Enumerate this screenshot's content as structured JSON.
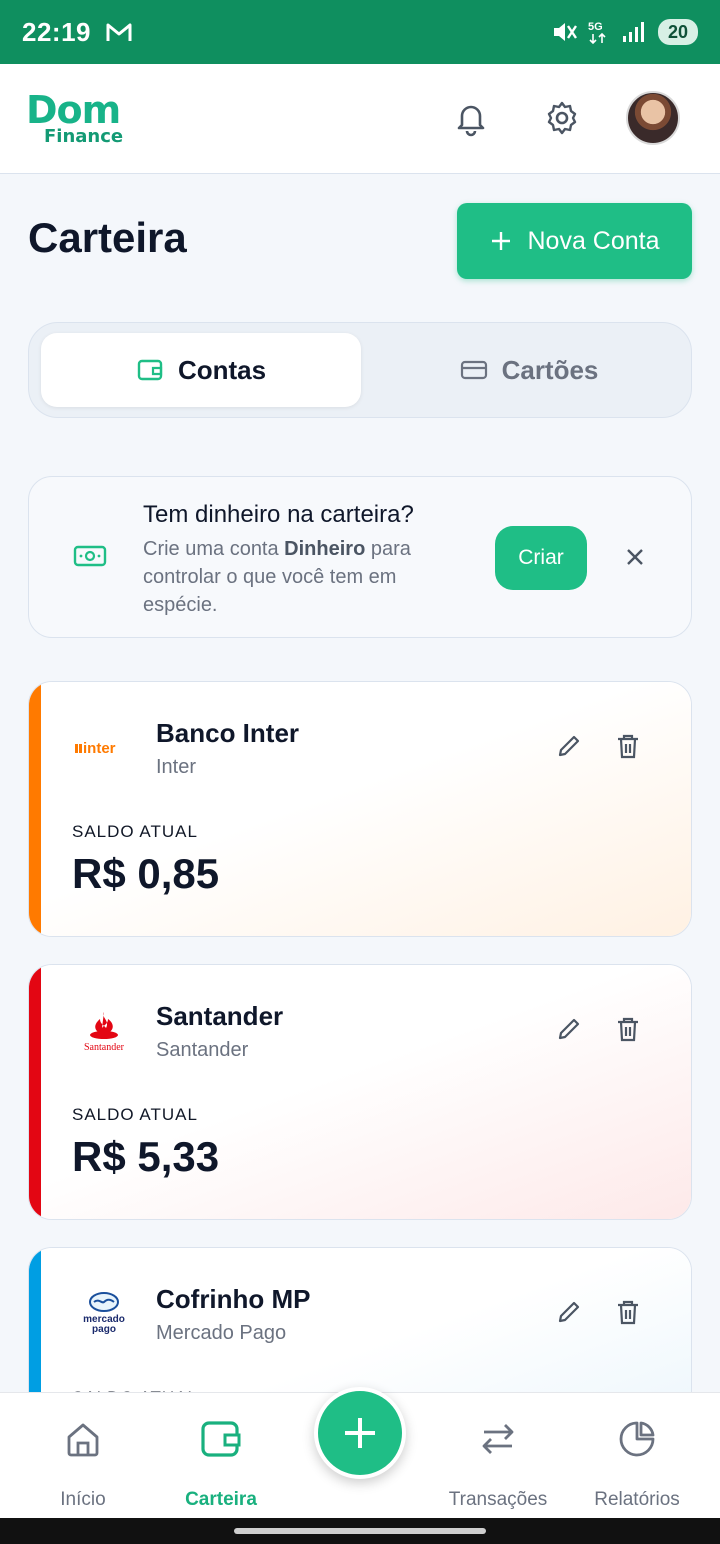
{
  "status_bar": {
    "time": "22:19",
    "battery": "20"
  },
  "app": {
    "logo_line1": "Dom",
    "logo_line2": "Finance"
  },
  "page": {
    "title": "Carteira",
    "new_account_label": "Nova Conta"
  },
  "tabs": [
    {
      "label": "Contas",
      "active": true
    },
    {
      "label": "Cartões",
      "active": false
    }
  ],
  "tip": {
    "title": "Tem dinheiro na carteira?",
    "text_before": "Crie uma conta ",
    "text_bold": "Dinheiro",
    "text_after": " para controlar o que você tem em espécie.",
    "button_label": "Criar"
  },
  "accounts": [
    {
      "name": "Banco Inter",
      "institution": "Inter",
      "balance_label": "SALDO ATUAL",
      "balance": "R$ 0,85",
      "logo_text": "inter",
      "color": "#ff7a00"
    },
    {
      "name": "Santander",
      "institution": "Santander",
      "balance_label": "SALDO ATUAL",
      "balance": "R$ 5,33",
      "logo_text": "Santander",
      "color": "#e30613"
    },
    {
      "name": "Cofrinho MP",
      "institution": "Mercado Pago",
      "balance_label": "SALDO ATUAL",
      "balance": "",
      "logo_text": "mercado pago",
      "color": "#009ee3"
    }
  ],
  "bottom_nav": [
    {
      "label": "Início",
      "icon": "home-icon",
      "active": false
    },
    {
      "label": "Carteira",
      "icon": "wallet-icon",
      "active": true
    },
    {
      "label": "Transações",
      "icon": "transfer-icon",
      "active": false
    },
    {
      "label": "Relatórios",
      "icon": "pie-chart-icon",
      "active": false
    }
  ],
  "colors": {
    "primary": "#1fbe86",
    "status_bar": "#0f8f5f"
  }
}
